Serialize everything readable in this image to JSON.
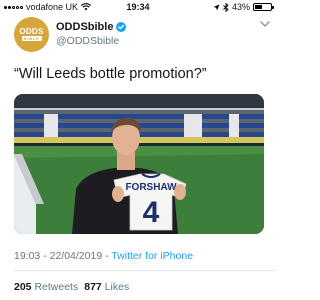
{
  "status_bar": {
    "carrier": "vodafone UK",
    "time": "19:34",
    "battery": "43%",
    "battery_level": 0.43,
    "signal_bars_filled": 2,
    "icons": [
      "signal-icon",
      "wifi-icon",
      "location-icon",
      "bluetooth-icon",
      "battery-icon"
    ]
  },
  "tweet": {
    "avatar_text_top": "ODDS",
    "avatar_text_bottom": "BIBLE",
    "display_name": "ODDSbible",
    "verified": true,
    "handle": "@ODDSbible",
    "text": "“Will Leeds bottle promotion?”",
    "media": {
      "shirt_name": "FORSHAW",
      "shirt_number": "4"
    },
    "timestamp": "19:03 - 22/04/2019",
    "separator": " - ",
    "source": "Twitter for iPhone",
    "retweets_count": "205",
    "retweets_label": "Retweets",
    "likes_count": "877",
    "likes_label": "Likes"
  },
  "colors": {
    "brand": "#d7a63a",
    "link": "#1da1f2",
    "muted": "#657786",
    "verified": "#1da1f2"
  }
}
